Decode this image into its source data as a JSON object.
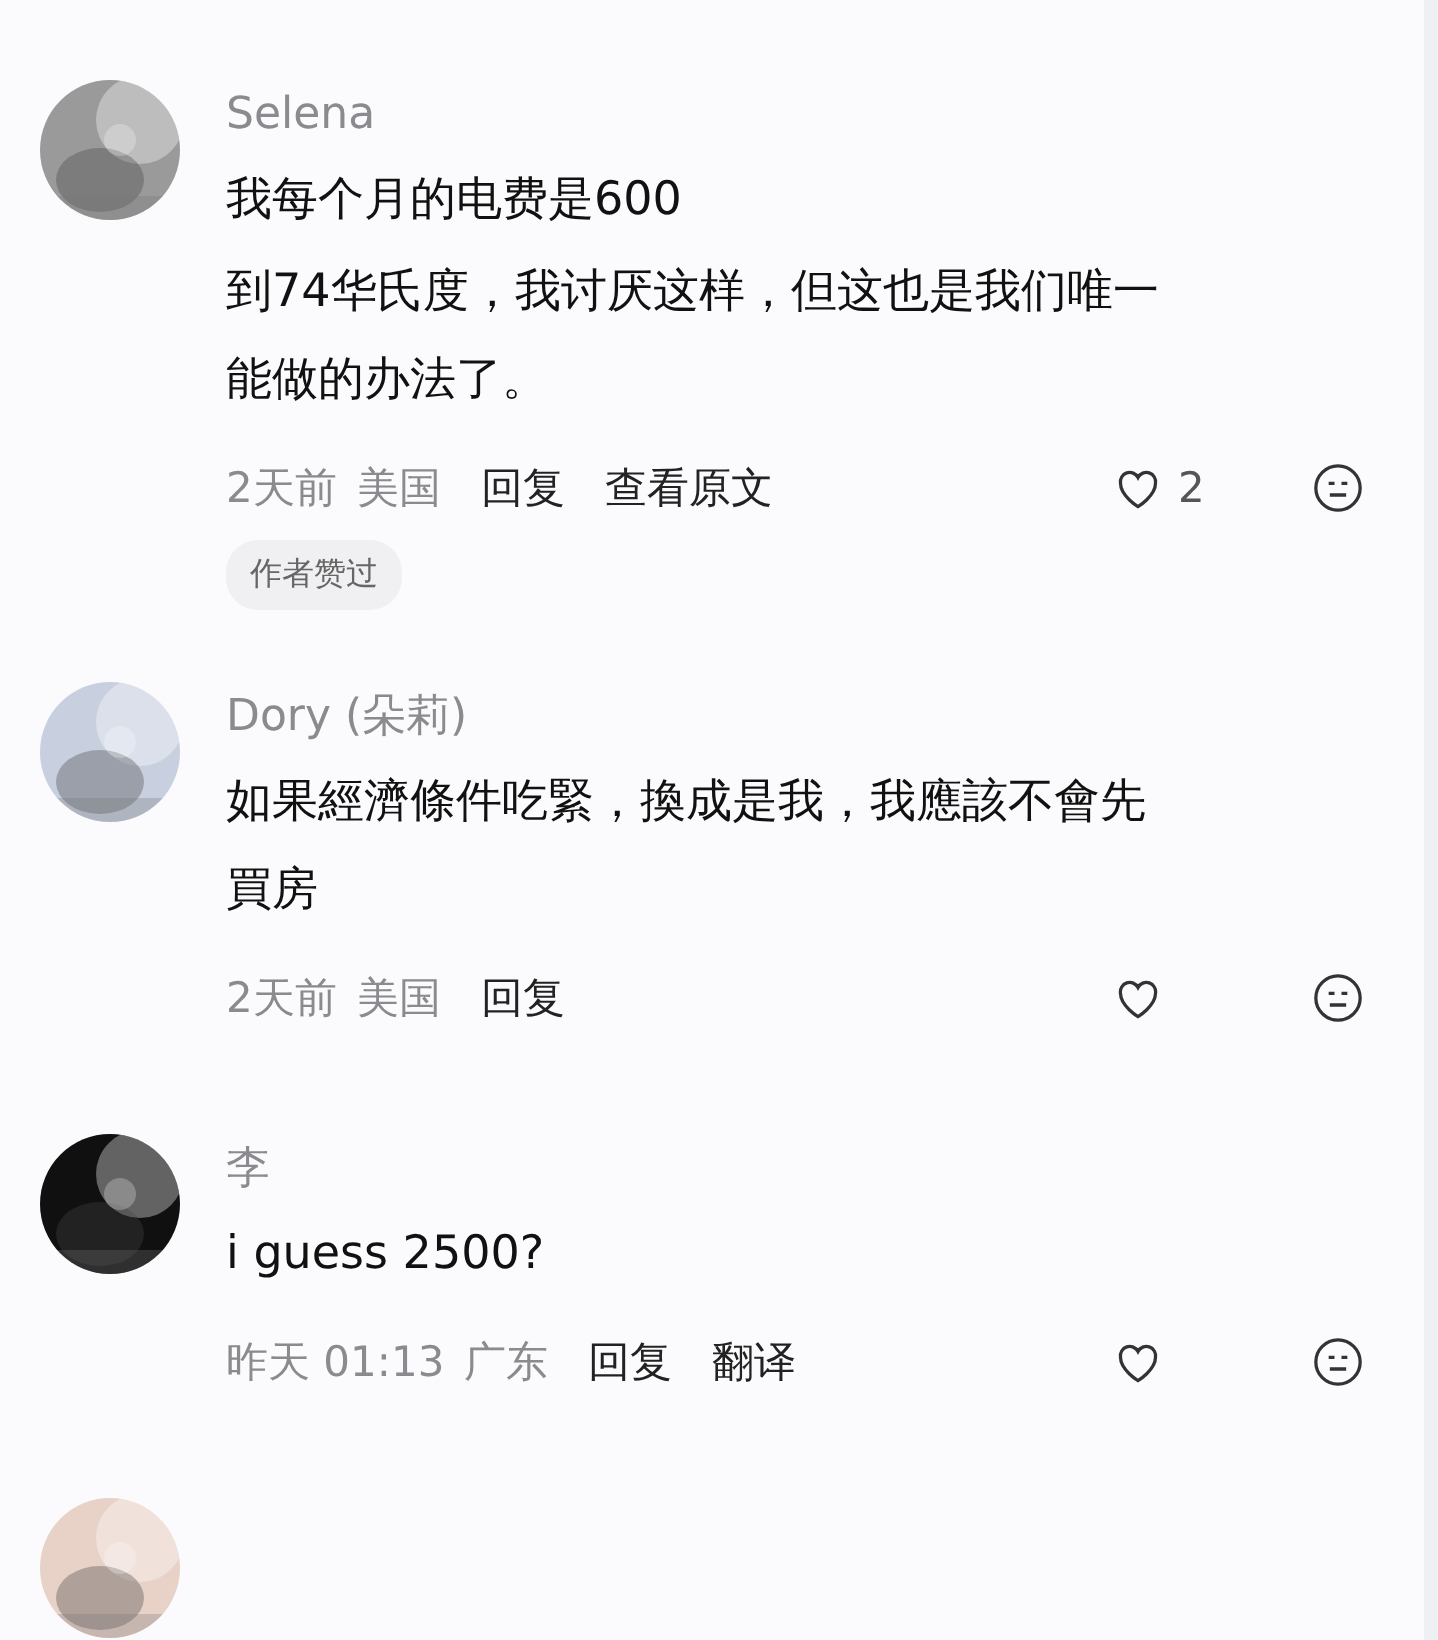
{
  "comments": [
    {
      "avatar": {
        "kind": "picture"
      },
      "name": "Selena",
      "body": [
        "我每个月的电费是600",
        "到74华氏度，我讨厌这样，但这也是我们唯一能做的办法了。"
      ],
      "time": "2天前",
      "location": "美国",
      "actions": [
        "回复",
        "查看原文"
      ],
      "likes": "2",
      "badge": "作者赞过"
    },
    {
      "avatar": {
        "kind": "picture"
      },
      "name": "Dory (朵莉)",
      "body": [
        "如果經濟條件吃緊，換成是我，我應該不會先買房"
      ],
      "time": "2天前",
      "location": "美国",
      "actions": [
        "回复"
      ]
    },
    {
      "avatar": {
        "kind": "picture"
      },
      "name": "李",
      "body": [
        "i guess 2500?"
      ],
      "time": "昨天 01:13",
      "location": "广东",
      "actions": [
        "回复",
        "翻译"
      ]
    },
    {
      "avatar": {
        "kind": "picture"
      }
    }
  ]
}
